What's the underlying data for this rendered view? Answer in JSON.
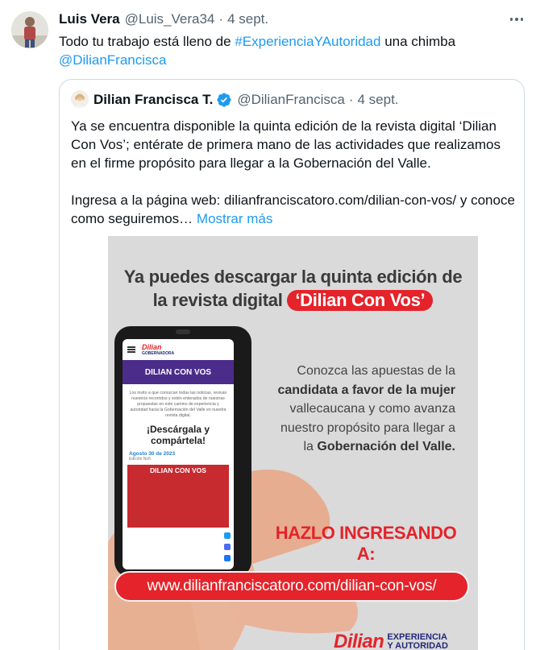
{
  "tweet": {
    "author_name": "Luis Vera",
    "author_handle": "@Luis_Vera34",
    "separator": "·",
    "time": "4 sept.",
    "text_prefix": "Todo tu trabajo está lleno de ",
    "hashtag": "#ExperienciaYAutoridad",
    "text_suffix": " una chimba",
    "mention": "@DilianFrancisca"
  },
  "quoted": {
    "author_name": "Dilian Francisca T.",
    "author_handle": "@DilianFrancisca",
    "separator": "·",
    "time": "4 sept.",
    "paragraph_1": "Ya se encuentra disponible la quinta edición de la revista digital ‘Dilian Con Vos’; entérate de primera mano de las actividades que realizamos en el firme propósito para llegar a la Gobernación del Valle.",
    "paragraph_2": "Ingresa a la página web: dilianfranciscatoro.com/dilian-con-vos/ y conoce como seguiremos…",
    "show_more": "Mostrar más"
  },
  "poster": {
    "headline_1": "Ya puedes descargar la quinta edición de",
    "headline_2": "la revista digital",
    "headline_pill": "‘Dilian Con Vos’",
    "body_1": "Conozca las apuestas de la",
    "body_2": "candidata a favor de la mujer",
    "body_3": "vallecaucana y como avanza",
    "body_4": "nuestro propósito para llegar a",
    "body_5_pre": "la ",
    "body_5_bold": "Gobernación del Valle.",
    "cta": "HAZLO INGRESANDO A:",
    "url": "www.dilianfranciscatoro.com/dilian-con-vos/",
    "brand_word": "Dilian",
    "brand_tag_1": "EXPERIENCIA",
    "brand_tag_2": "Y AUTORIDAD",
    "phone": {
      "logo": "Dilian",
      "logo_tag": "GOBERNADORA",
      "band": "DILIAN CON VOS",
      "paragraph": "Los invito a que conozcan todas las noticias, revivan nuestros recorridos y estén enterados de nuestras propuestas en este camino de experiencia y autoridad hacia la Gobernación del Valle en nuestra revista digital.",
      "big_1": "¡Descárgala y",
      "big_2": "compártela!",
      "date": "Agosto 30 de 2023",
      "edition": "Edición No5",
      "cover_title": "DILIAN CON VOS"
    }
  },
  "colors": {
    "link": "#1d9bf0",
    "brand_red": "#e4232a",
    "brand_purple": "#4b2c8a",
    "muted": "#536471"
  }
}
